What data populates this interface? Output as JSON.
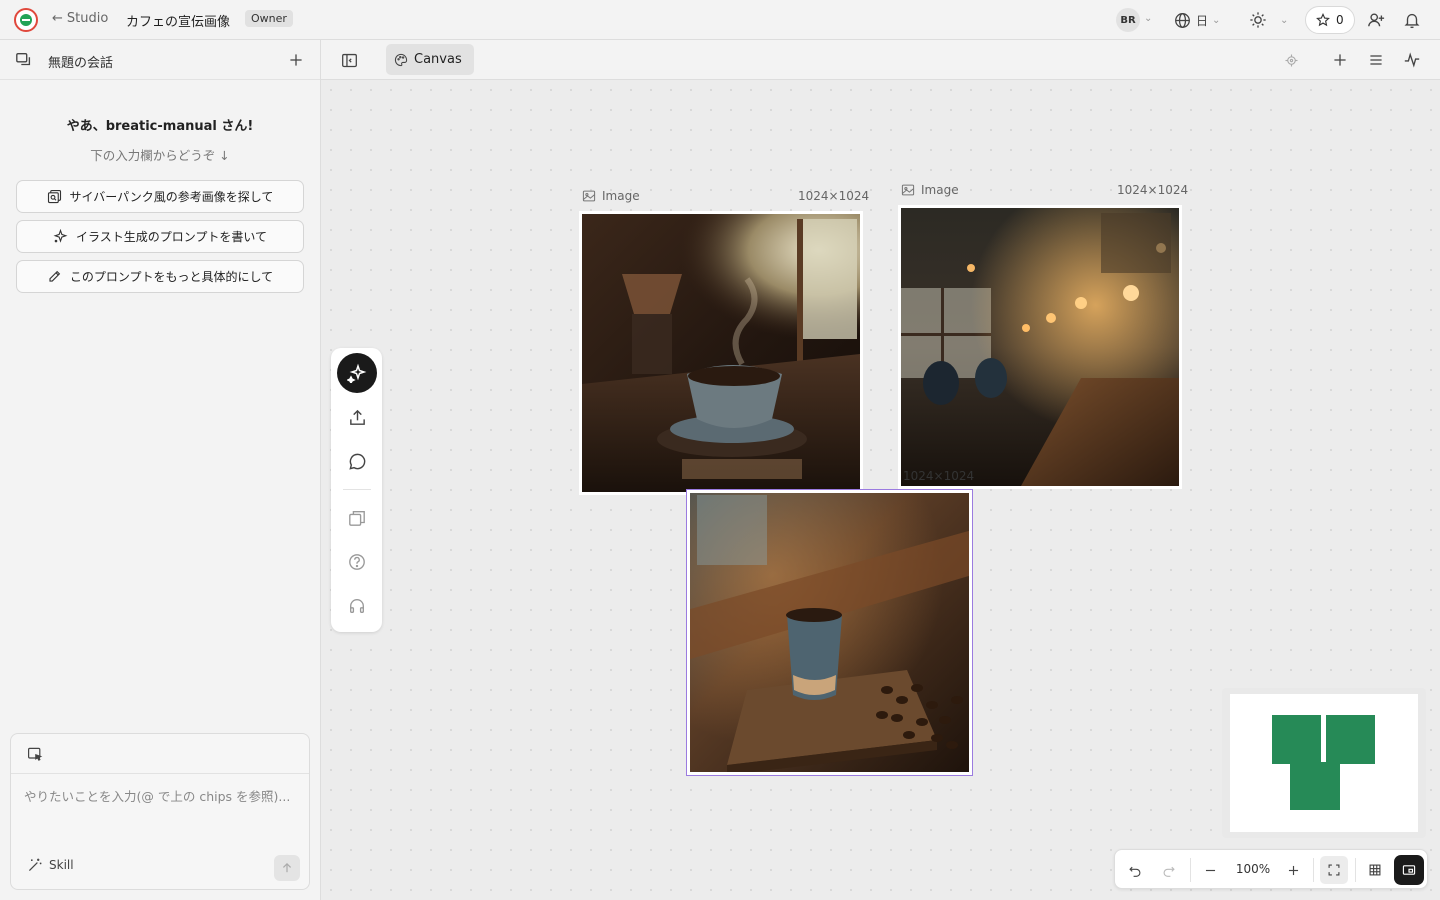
{
  "topbar": {
    "back_label": "Studio",
    "project_title": "カフェの宣伝画像",
    "role_badge": "Owner",
    "avatar_initials": "BR",
    "language": "日",
    "credits": "0"
  },
  "sidebar": {
    "conversation_title": "無題の会話",
    "greeting": "やあ、breatic-manual さん!",
    "greeting_sub": "下の入力欄からどうぞ ↓",
    "chips": [
      {
        "label": "サイバーパンク風の参考画像を探して",
        "icon": "image-search-icon"
      },
      {
        "label": "イラスト生成のプロンプトを書いて",
        "icon": "sparkle-icon"
      },
      {
        "label": "このプロンプトをもっと具体的にして",
        "icon": "pencil-icon"
      }
    ],
    "composer": {
      "placeholder": "やりたいことを入力(@ で上の chips を参照)...",
      "skill_label": "Skill"
    }
  },
  "canvas": {
    "tab_label": "Canvas",
    "images": [
      {
        "label": "Image",
        "size": "1024×1024",
        "subject": "steaming coffee cup by window"
      },
      {
        "label": "Image",
        "size": "1024×1024",
        "subject": "warm cafe interior with bar"
      },
      {
        "label": "",
        "size": "",
        "subject": "coffee cup on wooden board with beans"
      }
    ],
    "overlap_label": "1024×1024",
    "zoom_level": "100%"
  },
  "colors": {
    "accent": "#268a57",
    "selection": "#9b7be0",
    "logo_red": "#e0483c",
    "logo_green": "#21a356"
  }
}
